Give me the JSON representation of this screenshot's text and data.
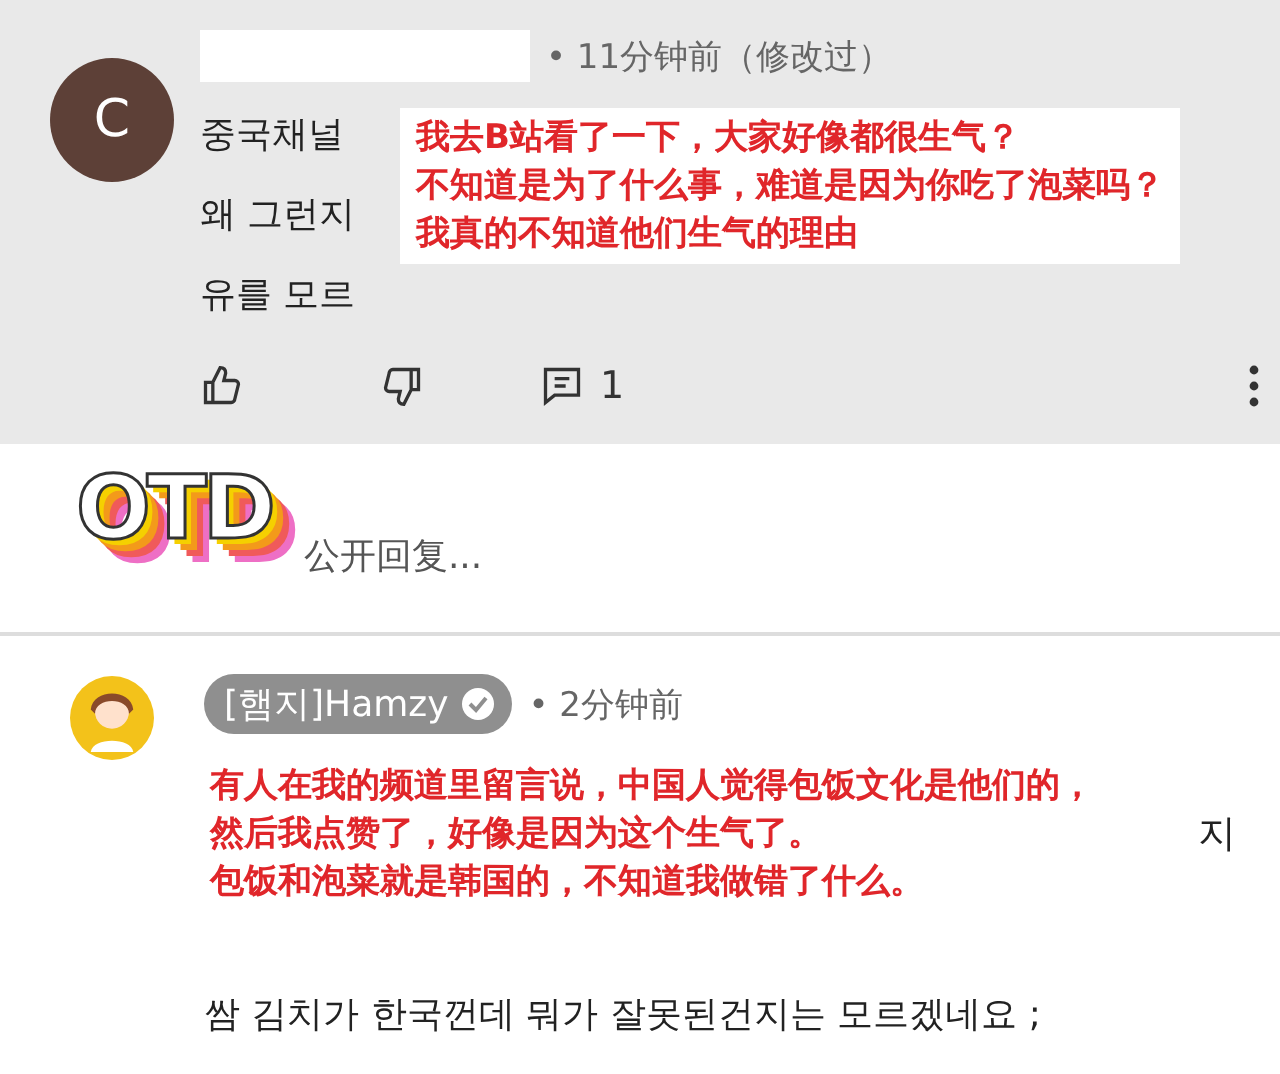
{
  "comments": [
    {
      "avatar": {
        "kind": "letter",
        "letter": "C"
      },
      "meta": "• 11分钟前（修改过）",
      "lines": [
        "중국채널",
        "왜 그런지",
        "유를 모르"
      ],
      "annotation": [
        "我去B站看了一下，大家好像都很生气？",
        "不知道是为了什么事，难道是因为你吃了泡菜吗？",
        "我真的不知道他们生气的理由"
      ],
      "actions": {
        "reply_count": "1"
      }
    },
    {
      "avatar": {
        "kind": "picture"
      },
      "author": "[햄지]Hamzy",
      "verified": true,
      "meta": "• 2分钟前",
      "side_fragment": "지",
      "annotation": [
        "有人在我的频道里留言说，中国人觉得包饭文化是他们的，",
        "然后我点赞了，好像是因为这个生气了。",
        "包饭和泡菜就是韩国的，不知道我做错了什么。"
      ],
      "lines": [
        "쌈 김치가 한국껀데 뭐가 잘못된건지는 모르겠네요 ;"
      ]
    }
  ],
  "reply_box": {
    "sticker": "OTD",
    "placeholder": "公开回复..."
  }
}
